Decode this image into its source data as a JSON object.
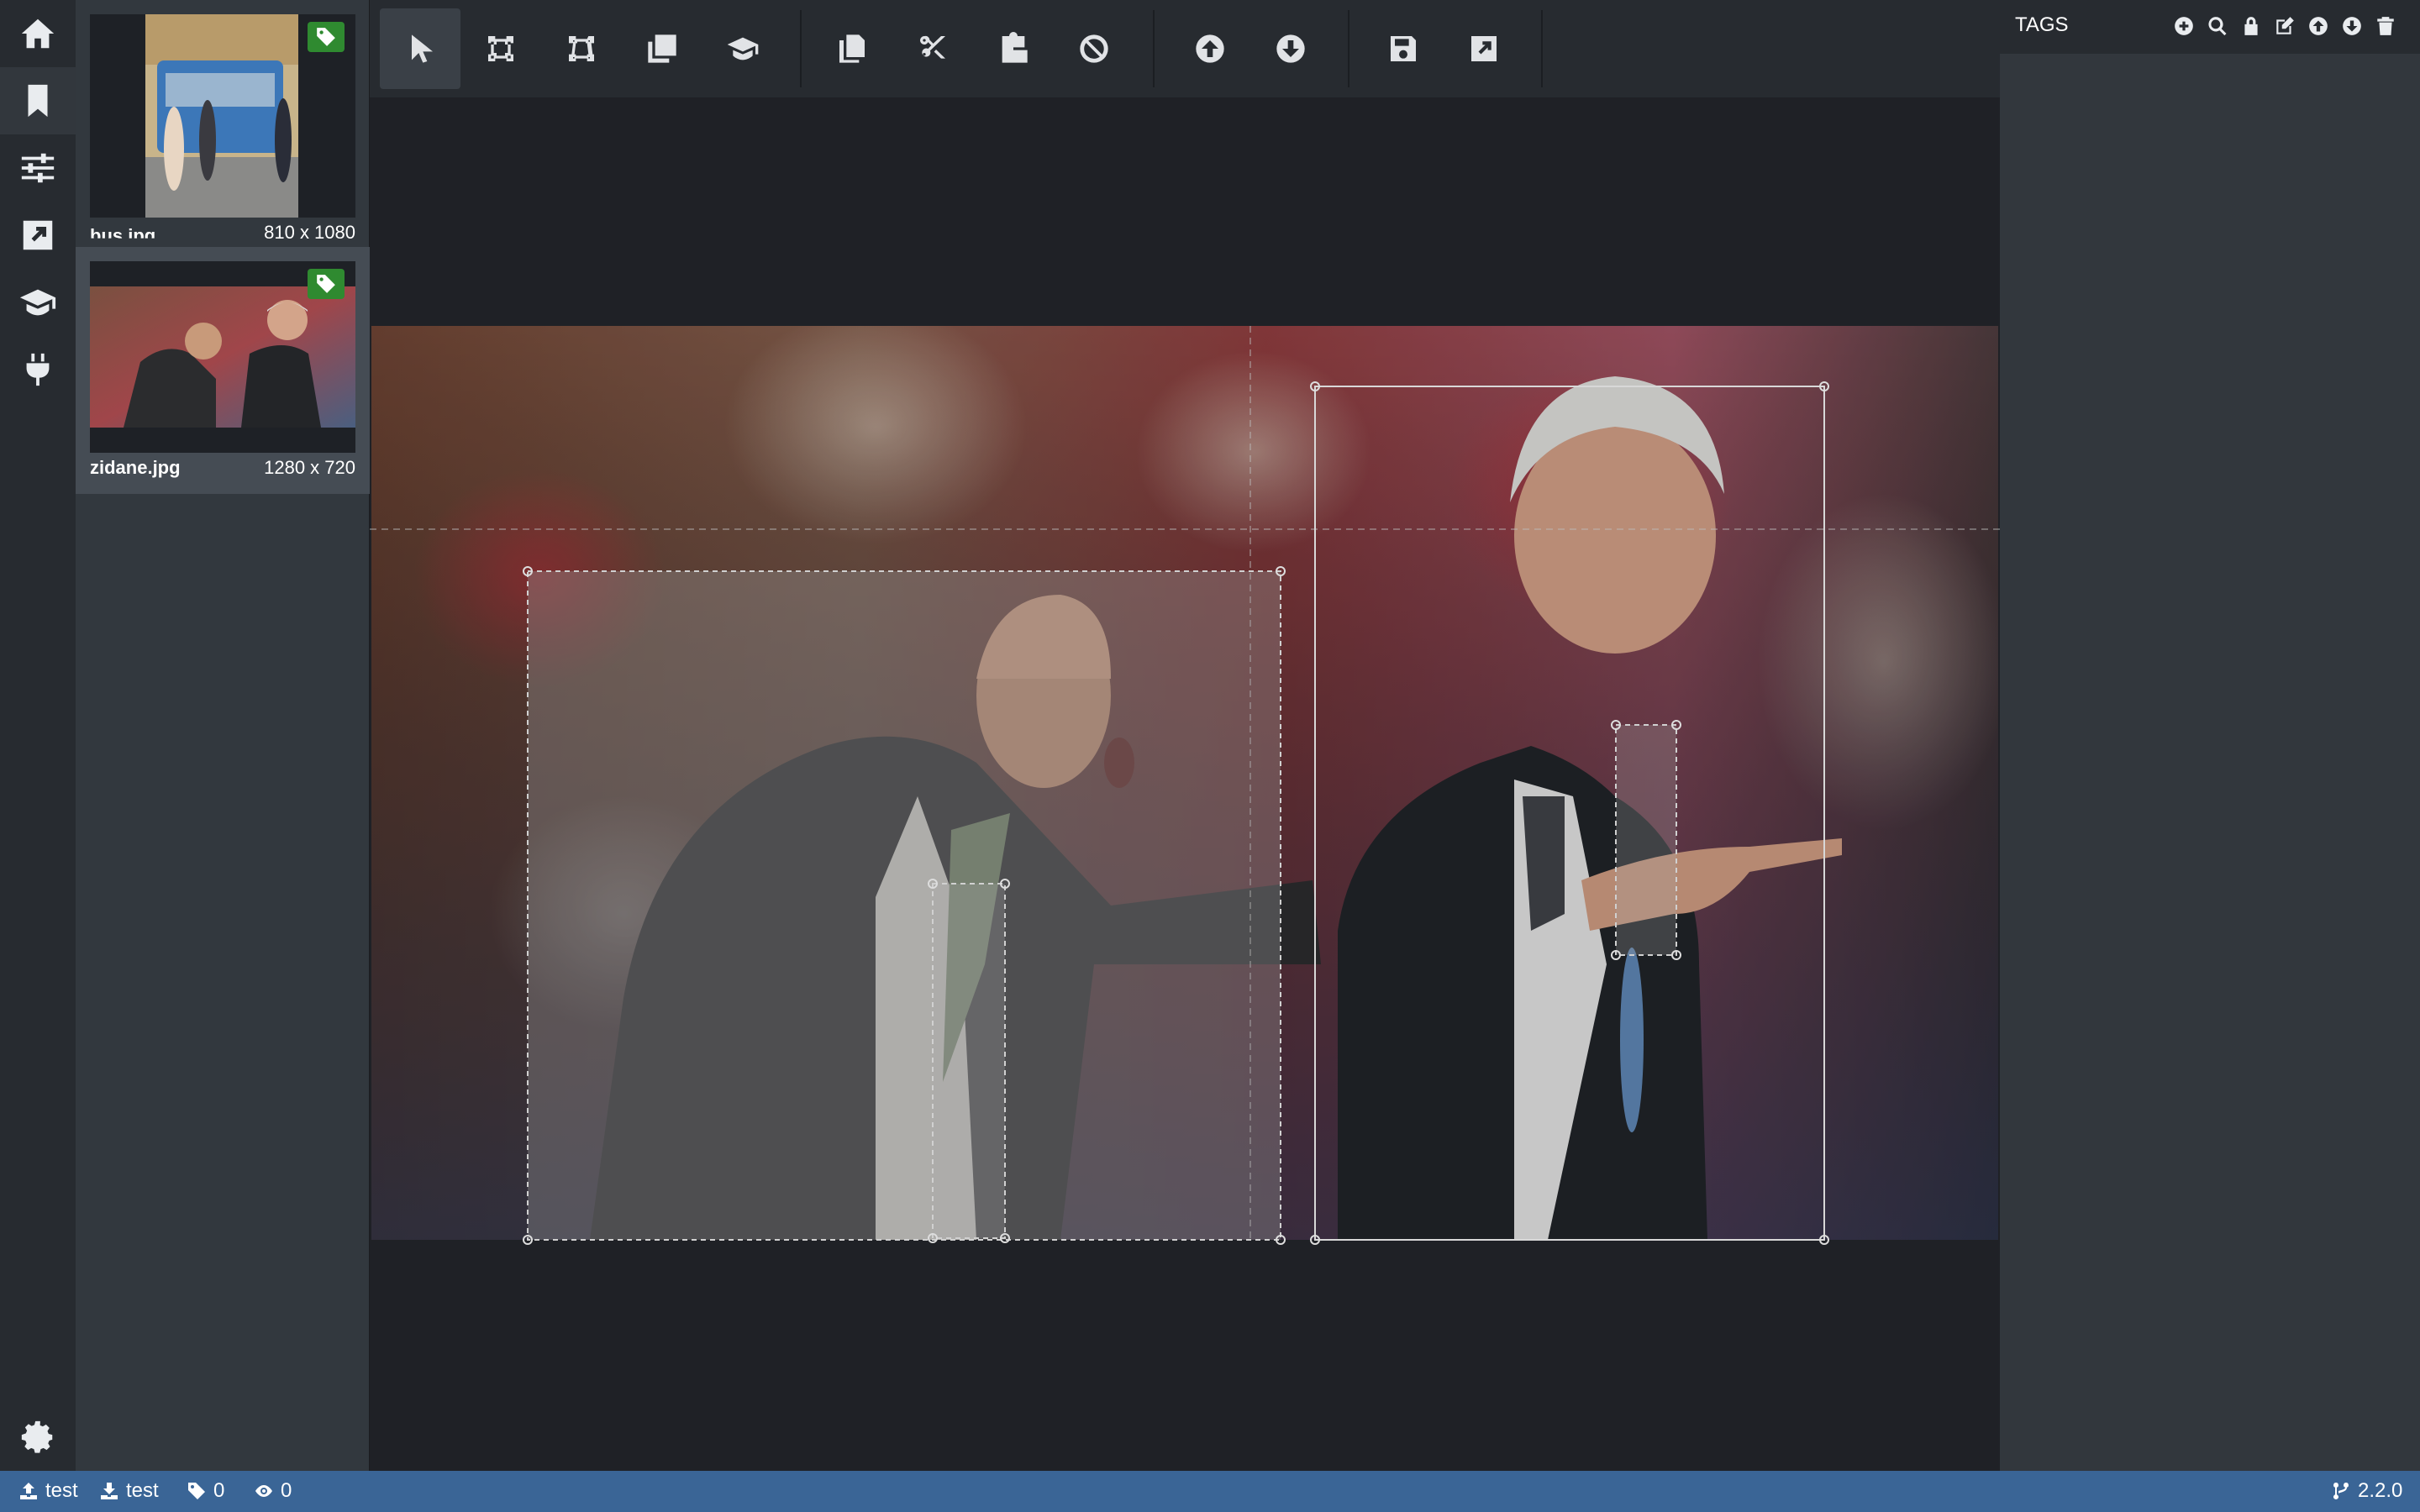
{
  "sidebar": {
    "items": [
      {
        "name": "home",
        "icon": "home-icon"
      },
      {
        "name": "editor",
        "icon": "bookmark-icon",
        "active": true
      },
      {
        "name": "settings",
        "icon": "sliders-icon"
      },
      {
        "name": "export",
        "icon": "external-link-icon"
      },
      {
        "name": "active-learning",
        "icon": "graduation-cap-icon"
      },
      {
        "name": "connections",
        "icon": "plug-icon"
      }
    ],
    "bottom_icon": "gear-icon"
  },
  "thumbnails": [
    {
      "filename": "bus.jpg",
      "size": "810 x 1080",
      "tagged": true,
      "active": false
    },
    {
      "filename": "zidane.jpg",
      "size": "1280 x 720",
      "tagged": true,
      "active": true
    }
  ],
  "toolbar": {
    "groups": [
      [
        "select-icon",
        "rectangle-icon",
        "polygon-icon",
        "copy-rectangle-icon",
        "active-learning-icon"
      ],
      [
        "copy-icon",
        "cut-icon",
        "paste-icon",
        "clear-icon"
      ],
      [
        "previous-icon",
        "next-icon"
      ],
      [
        "save-icon",
        "export-icon"
      ]
    ],
    "selected_tool": "select-icon"
  },
  "tags_panel": {
    "title": "TAGS",
    "actions": [
      "add-tag-icon",
      "search-tag-icon",
      "lock-tag-icon",
      "edit-tag-icon",
      "move-up-icon",
      "move-down-icon",
      "delete-tag-icon"
    ]
  },
  "status": {
    "source": "test",
    "target": "test",
    "tags_count": "0",
    "visited_count": "0",
    "version": "2.2.0"
  },
  "colors": {
    "status_bar": "#3a6596",
    "tag_badge": "#2f8a30",
    "panel_bg": "#32373d"
  }
}
